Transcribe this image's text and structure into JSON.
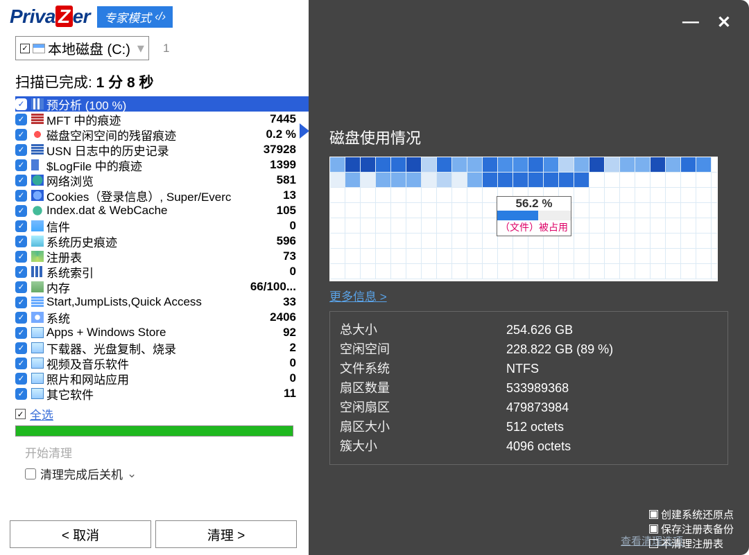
{
  "logo": {
    "pre": "Priva",
    "z": "Z",
    "post": "er"
  },
  "mode_badge": "专家模式",
  "disk": {
    "label": "本地磁盘 (C:)",
    "count": "1"
  },
  "scan_status_prefix": "扫描已完成: ",
  "scan_status_time": "1 分 8 秒",
  "items": [
    {
      "label": "预分析 (100 %)",
      "val": "",
      "selected": true,
      "ic": "ic-grid"
    },
    {
      "label": "MFT 中的痕迹",
      "val": "7445",
      "ic": "ic-bars"
    },
    {
      "label": "磁盘空闲空间的残留痕迹",
      "val": "0.2 %",
      "ic": "ic-free"
    },
    {
      "label": "USN 日志中的历史记录",
      "val": "37928",
      "ic": "ic-usn"
    },
    {
      "label": "$LogFile 中的痕迹",
      "val": "1399",
      "ic": "ic-log"
    },
    {
      "label": "网络浏览",
      "val": "581",
      "ic": "ic-web"
    },
    {
      "label": "Cookies（登录信息）, Super/Everc",
      "val": "13",
      "ic": "ic-cookie"
    },
    {
      "label": "Index.dat & WebCache",
      "val": "105",
      "ic": "ic-index"
    },
    {
      "label": "信件",
      "val": "0",
      "ic": "ic-mail"
    },
    {
      "label": "系统历史痕迹",
      "val": "596",
      "ic": "ic-sys"
    },
    {
      "label": "注册表",
      "val": "73",
      "ic": "ic-reg"
    },
    {
      "label": "系统索引",
      "val": "0",
      "ic": "ic-idx"
    },
    {
      "label": "内存",
      "val": "66/100...",
      "ic": "ic-mem"
    },
    {
      "label": "Start,JumpLists,Quick Access",
      "val": "33",
      "ic": "ic-start"
    },
    {
      "label": "系统",
      "val": "2406",
      "ic": "ic-gear"
    },
    {
      "label": "Apps + Windows Store",
      "val": "92",
      "ic": "ic-app"
    },
    {
      "label": "下载器、光盘复制、烧录",
      "val": "2",
      "ic": "ic-app"
    },
    {
      "label": "视频及音乐软件",
      "val": "0",
      "ic": "ic-app"
    },
    {
      "label": "照片和网站应用",
      "val": "0",
      "ic": "ic-app"
    },
    {
      "label": "其它软件",
      "val": "11",
      "ic": "ic-app"
    }
  ],
  "select_all": "全选",
  "start_clean": "开始清理",
  "shutdown_after": "清理完成后关机",
  "btn_cancel": "< 取消",
  "btn_clean": "清理 >",
  "right": {
    "disk_usage": "磁盘使用情况",
    "tooltip_pct": "56.2 %",
    "tooltip_label": "（文件）被占用",
    "more_info": "更多信息 >",
    "rows": [
      {
        "k": "总大小",
        "v": "254.626 GB"
      },
      {
        "k": "空闲空间",
        "v": "228.822 GB (89 %)"
      },
      {
        "k": "文件系统",
        "v": "NTFS"
      },
      {
        "k": "扇区数量",
        "v": "533989368"
      },
      {
        "k": "空闲扇区",
        "v": "479873984"
      },
      {
        "k": "扇区大小",
        "v": "512 octets"
      },
      {
        "k": "簇大小",
        "v": "4096 octets"
      }
    ],
    "view_options": "查看清理选项",
    "opts": [
      {
        "label": "创建系统还原点",
        "on": true
      },
      {
        "label": "保存注册表备份",
        "on": true
      },
      {
        "label": "不清理注册表",
        "on": false
      }
    ]
  }
}
